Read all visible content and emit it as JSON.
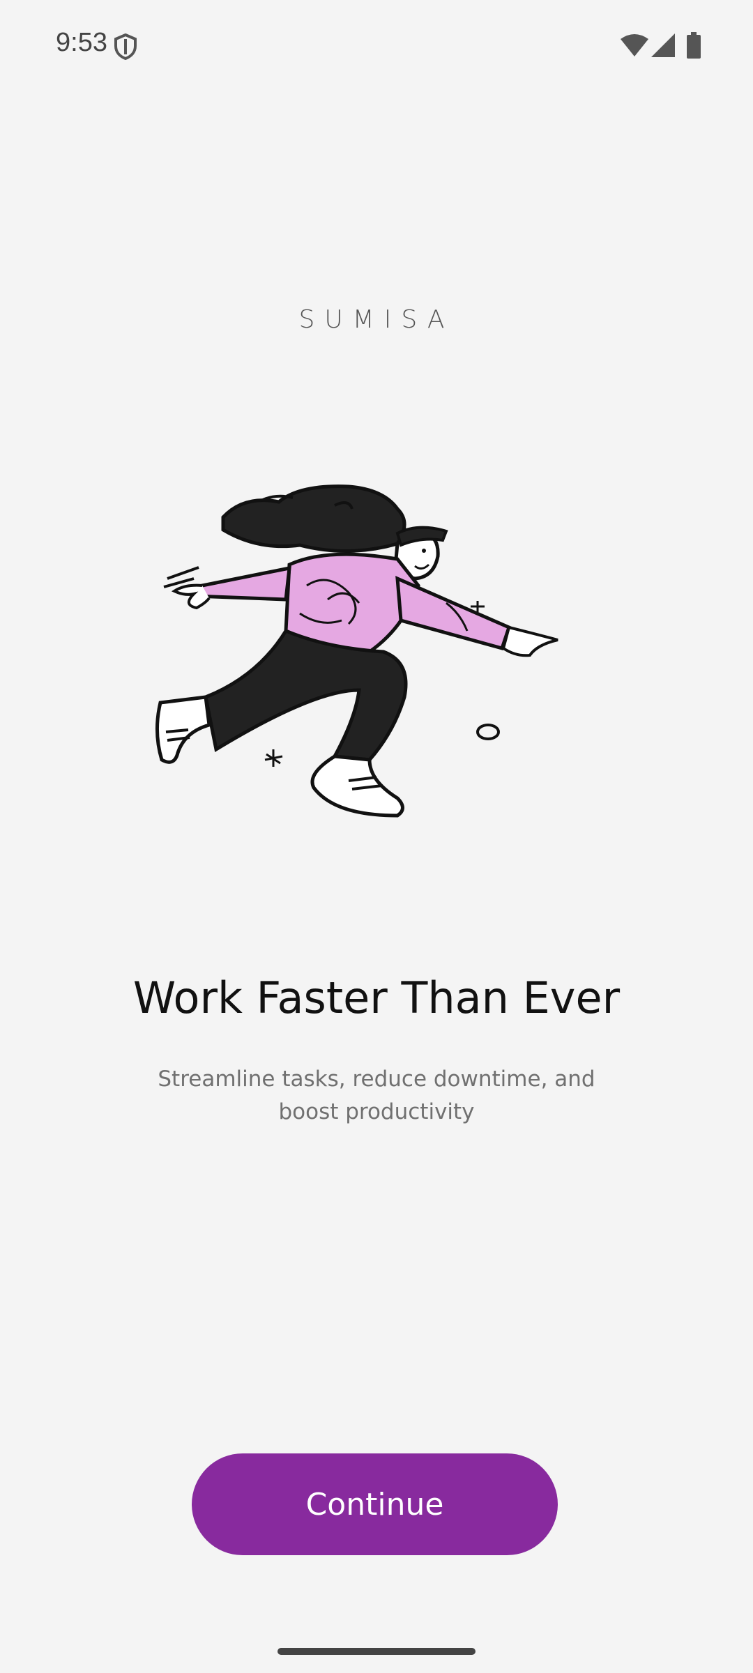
{
  "status_bar": {
    "time": "9:53",
    "icons": [
      "shield-icon",
      "wifi-icon",
      "signal-icon",
      "battery-icon"
    ]
  },
  "brand": {
    "name": "SUMISA"
  },
  "onboarding": {
    "illustration": "running-person-illustration",
    "headline": "Work Faster Than Ever",
    "subtitle": "Streamline tasks, reduce downtime, and boost productivity",
    "continue_label": "Continue"
  },
  "colors": {
    "background": "#f4f4f4",
    "accent": "#882a9e",
    "sweater": "#e5a8e2"
  }
}
